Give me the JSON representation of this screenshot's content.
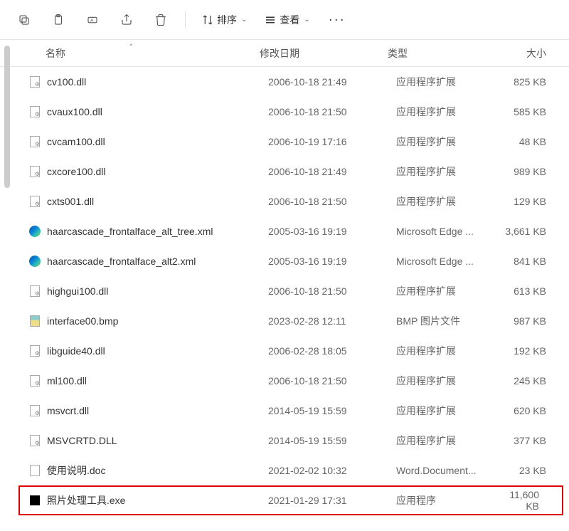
{
  "toolbar": {
    "sort_label": "排序",
    "view_label": "查看"
  },
  "columns": {
    "name": "名称",
    "date": "修改日期",
    "type": "类型",
    "size": "大小"
  },
  "files": [
    {
      "icon": "dll",
      "name": "cv100.dll",
      "date": "2006-10-18 21:49",
      "type": "应用程序扩展",
      "size": "825 KB",
      "highlighted": false
    },
    {
      "icon": "dll",
      "name": "cvaux100.dll",
      "date": "2006-10-18 21:50",
      "type": "应用程序扩展",
      "size": "585 KB",
      "highlighted": false
    },
    {
      "icon": "dll",
      "name": "cvcam100.dll",
      "date": "2006-10-19 17:16",
      "type": "应用程序扩展",
      "size": "48 KB",
      "highlighted": false
    },
    {
      "icon": "dll",
      "name": "cxcore100.dll",
      "date": "2006-10-18 21:49",
      "type": "应用程序扩展",
      "size": "989 KB",
      "highlighted": false
    },
    {
      "icon": "dll",
      "name": "cxts001.dll",
      "date": "2006-10-18 21:50",
      "type": "应用程序扩展",
      "size": "129 KB",
      "highlighted": false
    },
    {
      "icon": "edge",
      "name": "haarcascade_frontalface_alt_tree.xml",
      "date": "2005-03-16 19:19",
      "type": "Microsoft Edge ...",
      "size": "3,661 KB",
      "highlighted": false
    },
    {
      "icon": "edge",
      "name": "haarcascade_frontalface_alt2.xml",
      "date": "2005-03-16 19:19",
      "type": "Microsoft Edge ...",
      "size": "841 KB",
      "highlighted": false
    },
    {
      "icon": "dll",
      "name": "highgui100.dll",
      "date": "2006-10-18 21:50",
      "type": "应用程序扩展",
      "size": "613 KB",
      "highlighted": false
    },
    {
      "icon": "bmp",
      "name": "interface00.bmp",
      "date": "2023-02-28 12:11",
      "type": "BMP 图片文件",
      "size": "987 KB",
      "highlighted": false
    },
    {
      "icon": "dll",
      "name": "libguide40.dll",
      "date": "2006-02-28 18:05",
      "type": "应用程序扩展",
      "size": "192 KB",
      "highlighted": false
    },
    {
      "icon": "dll",
      "name": "ml100.dll",
      "date": "2006-10-18 21:50",
      "type": "应用程序扩展",
      "size": "245 KB",
      "highlighted": false
    },
    {
      "icon": "dll",
      "name": "msvcrt.dll",
      "date": "2014-05-19 15:59",
      "type": "应用程序扩展",
      "size": "620 KB",
      "highlighted": false
    },
    {
      "icon": "dll",
      "name": "MSVCRTD.DLL",
      "date": "2014-05-19 15:59",
      "type": "应用程序扩展",
      "size": "377 KB",
      "highlighted": false
    },
    {
      "icon": "doc",
      "name": "使用说明.doc",
      "date": "2021-02-02 10:32",
      "type": "Word.Document...",
      "size": "23 KB",
      "highlighted": false
    },
    {
      "icon": "exe",
      "name": "照片处理工具.exe",
      "date": "2021-01-29 17:31",
      "type": "应用程序",
      "size": "11,600 KB",
      "highlighted": true
    }
  ]
}
